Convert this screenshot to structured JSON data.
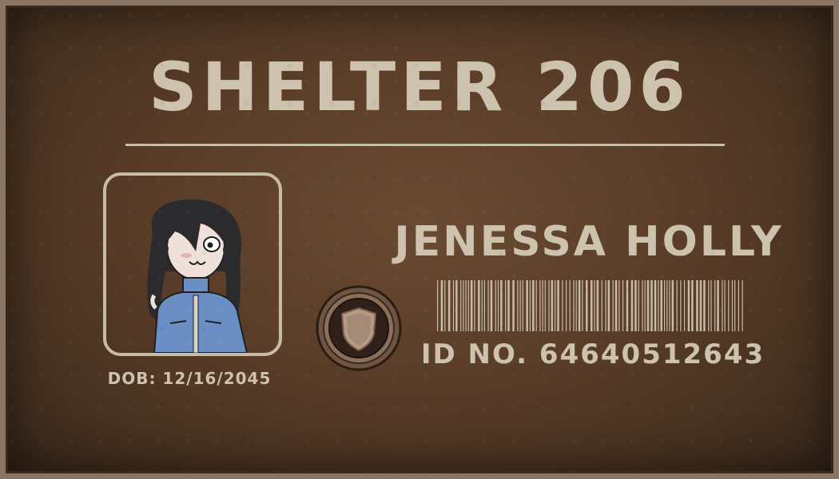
{
  "card": {
    "title": "SHELTER 206",
    "name": "JENESSA HOLLY",
    "dob": "DOB: 12/16/2045",
    "id_number": "ID NO. 64640512643"
  },
  "portrait": {
    "icon": "character-portrait"
  },
  "badge": {
    "icon": "shield-icon"
  },
  "colors": {
    "card_background": "#5a3d28",
    "border": "#8a7463",
    "text": "#cdc2ae",
    "jacket": "#6b8fc4",
    "hair": "#2b2b2e"
  }
}
